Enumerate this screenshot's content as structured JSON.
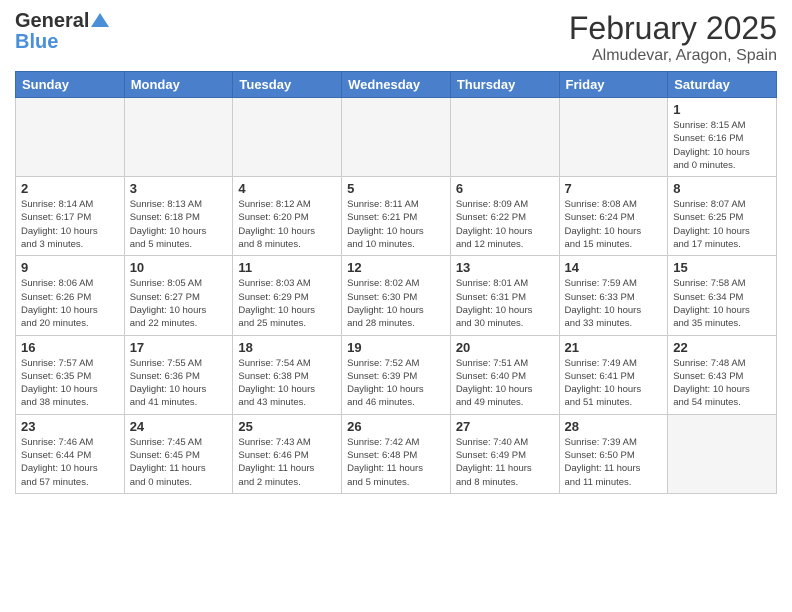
{
  "logo": {
    "line1": "General",
    "line2": "Blue"
  },
  "header": {
    "month": "February 2025",
    "location": "Almudevar, Aragon, Spain"
  },
  "weekdays": [
    "Sunday",
    "Monday",
    "Tuesday",
    "Wednesday",
    "Thursday",
    "Friday",
    "Saturday"
  ],
  "weeks": [
    [
      {
        "day": "",
        "info": ""
      },
      {
        "day": "",
        "info": ""
      },
      {
        "day": "",
        "info": ""
      },
      {
        "day": "",
        "info": ""
      },
      {
        "day": "",
        "info": ""
      },
      {
        "day": "",
        "info": ""
      },
      {
        "day": "1",
        "info": "Sunrise: 8:15 AM\nSunset: 6:16 PM\nDaylight: 10 hours\nand 0 minutes."
      }
    ],
    [
      {
        "day": "2",
        "info": "Sunrise: 8:14 AM\nSunset: 6:17 PM\nDaylight: 10 hours\nand 3 minutes."
      },
      {
        "day": "3",
        "info": "Sunrise: 8:13 AM\nSunset: 6:18 PM\nDaylight: 10 hours\nand 5 minutes."
      },
      {
        "day": "4",
        "info": "Sunrise: 8:12 AM\nSunset: 6:20 PM\nDaylight: 10 hours\nand 8 minutes."
      },
      {
        "day": "5",
        "info": "Sunrise: 8:11 AM\nSunset: 6:21 PM\nDaylight: 10 hours\nand 10 minutes."
      },
      {
        "day": "6",
        "info": "Sunrise: 8:09 AM\nSunset: 6:22 PM\nDaylight: 10 hours\nand 12 minutes."
      },
      {
        "day": "7",
        "info": "Sunrise: 8:08 AM\nSunset: 6:24 PM\nDaylight: 10 hours\nand 15 minutes."
      },
      {
        "day": "8",
        "info": "Sunrise: 8:07 AM\nSunset: 6:25 PM\nDaylight: 10 hours\nand 17 minutes."
      }
    ],
    [
      {
        "day": "9",
        "info": "Sunrise: 8:06 AM\nSunset: 6:26 PM\nDaylight: 10 hours\nand 20 minutes."
      },
      {
        "day": "10",
        "info": "Sunrise: 8:05 AM\nSunset: 6:27 PM\nDaylight: 10 hours\nand 22 minutes."
      },
      {
        "day": "11",
        "info": "Sunrise: 8:03 AM\nSunset: 6:29 PM\nDaylight: 10 hours\nand 25 minutes."
      },
      {
        "day": "12",
        "info": "Sunrise: 8:02 AM\nSunset: 6:30 PM\nDaylight: 10 hours\nand 28 minutes."
      },
      {
        "day": "13",
        "info": "Sunrise: 8:01 AM\nSunset: 6:31 PM\nDaylight: 10 hours\nand 30 minutes."
      },
      {
        "day": "14",
        "info": "Sunrise: 7:59 AM\nSunset: 6:33 PM\nDaylight: 10 hours\nand 33 minutes."
      },
      {
        "day": "15",
        "info": "Sunrise: 7:58 AM\nSunset: 6:34 PM\nDaylight: 10 hours\nand 35 minutes."
      }
    ],
    [
      {
        "day": "16",
        "info": "Sunrise: 7:57 AM\nSunset: 6:35 PM\nDaylight: 10 hours\nand 38 minutes."
      },
      {
        "day": "17",
        "info": "Sunrise: 7:55 AM\nSunset: 6:36 PM\nDaylight: 10 hours\nand 41 minutes."
      },
      {
        "day": "18",
        "info": "Sunrise: 7:54 AM\nSunset: 6:38 PM\nDaylight: 10 hours\nand 43 minutes."
      },
      {
        "day": "19",
        "info": "Sunrise: 7:52 AM\nSunset: 6:39 PM\nDaylight: 10 hours\nand 46 minutes."
      },
      {
        "day": "20",
        "info": "Sunrise: 7:51 AM\nSunset: 6:40 PM\nDaylight: 10 hours\nand 49 minutes."
      },
      {
        "day": "21",
        "info": "Sunrise: 7:49 AM\nSunset: 6:41 PM\nDaylight: 10 hours\nand 51 minutes."
      },
      {
        "day": "22",
        "info": "Sunrise: 7:48 AM\nSunset: 6:43 PM\nDaylight: 10 hours\nand 54 minutes."
      }
    ],
    [
      {
        "day": "23",
        "info": "Sunrise: 7:46 AM\nSunset: 6:44 PM\nDaylight: 10 hours\nand 57 minutes."
      },
      {
        "day": "24",
        "info": "Sunrise: 7:45 AM\nSunset: 6:45 PM\nDaylight: 11 hours\nand 0 minutes."
      },
      {
        "day": "25",
        "info": "Sunrise: 7:43 AM\nSunset: 6:46 PM\nDaylight: 11 hours\nand 2 minutes."
      },
      {
        "day": "26",
        "info": "Sunrise: 7:42 AM\nSunset: 6:48 PM\nDaylight: 11 hours\nand 5 minutes."
      },
      {
        "day": "27",
        "info": "Sunrise: 7:40 AM\nSunset: 6:49 PM\nDaylight: 11 hours\nand 8 minutes."
      },
      {
        "day": "28",
        "info": "Sunrise: 7:39 AM\nSunset: 6:50 PM\nDaylight: 11 hours\nand 11 minutes."
      },
      {
        "day": "",
        "info": ""
      }
    ]
  ]
}
